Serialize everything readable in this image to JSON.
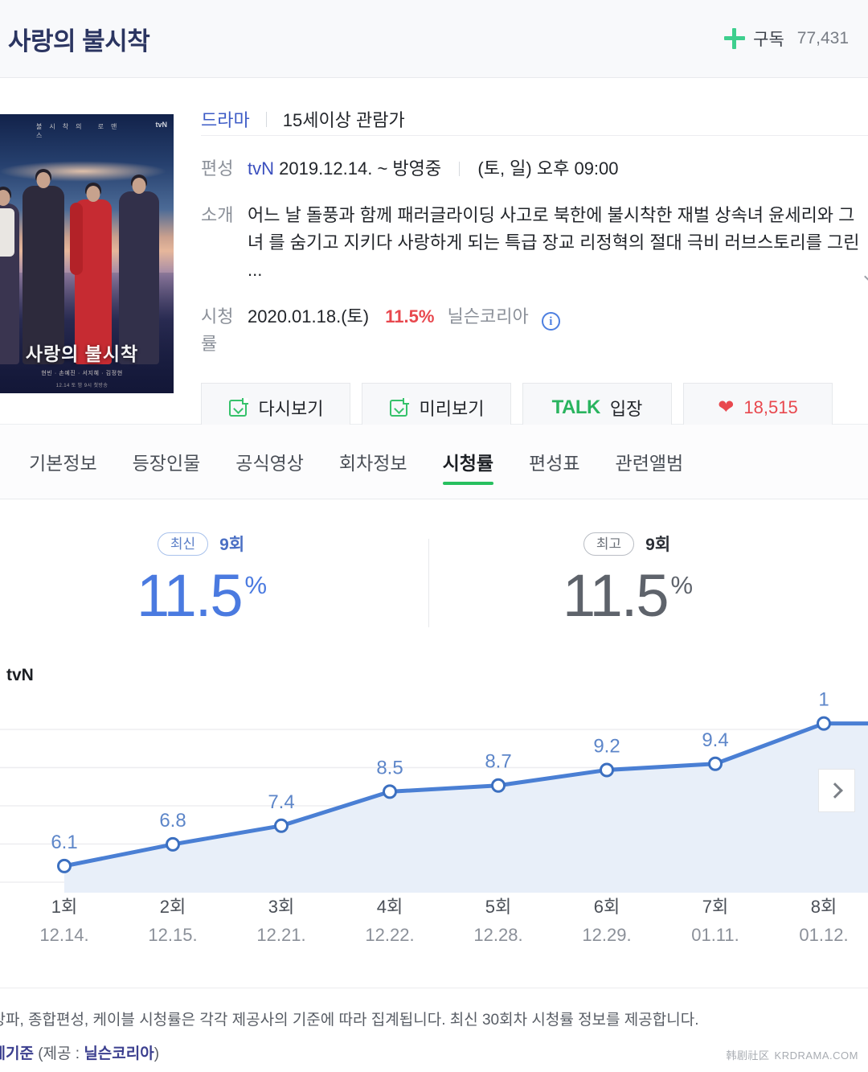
{
  "header": {
    "title": "사랑의 불시착",
    "subscribe_label": "구독",
    "subscribe_count": "77,431",
    "plus_icon": "plus-icon",
    "accent_green": "#3ecf8e",
    "title_color": "#2b3561"
  },
  "poster": {
    "title": "사랑의 불시착",
    "tagline": "불시착의 로맨스",
    "network_logo": "tvN",
    "credits": "현빈 · 손예진 · 서지혜 · 김정현",
    "credits2": "12.14 토 밤 9시 첫방송"
  },
  "info": {
    "genre": "드라마",
    "rating": "15세이상 관람가",
    "schedule_label": "편성",
    "channel": "tvN",
    "air_period": "2019.12.14. ~ 방영중",
    "air_time": "(토, 일) 오후 09:00",
    "synopsis_label": "소개",
    "synopsis_line1": "어느 날 돌풍과 함께 패러글라이딩 사고로 북한에 불시착한 재벌 상속녀 윤세리와 그녀",
    "synopsis_line2": "를 숨기고 지키다 사랑하게 되는 특급 장교 리정혁의 절대 극비 러브스토리를 그린 ...",
    "rating_label": "시청률",
    "rating_date": "2020.01.18.(토)",
    "rating_value": "11.5%",
    "rating_source": "닐슨코리아",
    "info_icon": "info-circle-icon",
    "rating_color": "#e8484e"
  },
  "buttons": {
    "vod": "다시보기",
    "preview": "미리보기",
    "talk_brand": "TALK",
    "talk_label": "입장",
    "like_icon": "heart-icon",
    "like_count": "18,515"
  },
  "tabs": [
    {
      "label": "기본정보",
      "active": false
    },
    {
      "label": "등장인물",
      "active": false
    },
    {
      "label": "공식영상",
      "active": false
    },
    {
      "label": "회차정보",
      "active": false
    },
    {
      "label": "시청률",
      "active": true
    },
    {
      "label": "편성표",
      "active": false
    },
    {
      "label": "관련앨범",
      "active": false
    }
  ],
  "stats": {
    "latest": {
      "badge": "최신",
      "episode": "9회",
      "value": "11.5",
      "unit": "%"
    },
    "best": {
      "badge": "최고",
      "episode": "9회",
      "value": "11.5",
      "unit": "%"
    }
  },
  "chart_data": {
    "type": "line",
    "title": "tvN",
    "xlabel": "",
    "ylabel": "",
    "ylim": [
      5.5,
      11.6
    ],
    "grid": true,
    "legend": false,
    "categories": [
      "1회",
      "2회",
      "3회",
      "4회",
      "5회",
      "6회",
      "7회",
      "8회"
    ],
    "tick_dates": [
      "12.14.",
      "12.15.",
      "12.21.",
      "12.22.",
      "12.28.",
      "12.29.",
      "01.11.",
      "01.12."
    ],
    "values": [
      6.1,
      6.8,
      7.4,
      8.5,
      8.7,
      9.2,
      9.4,
      10.7
    ],
    "value_labels": [
      "6.1",
      "6.8",
      "7.4",
      "8.5",
      "8.7",
      "9.2",
      "9.4",
      "1"
    ],
    "series": [
      {
        "name": "tvN",
        "values": [
          6.1,
          6.8,
          7.4,
          8.5,
          8.7,
          9.2,
          9.4,
          10.7
        ]
      }
    ],
    "line_color": "#4a7fd4",
    "fill_color": "#e8eff9",
    "marker_fill": "#ffffff",
    "next_button": "next-page-arrow"
  },
  "footer": {
    "note_line1": "지상파, 종합편성, 케이블 시청률은 각각 제공사의 기준에 따라 집계됩니다. 최신 30회차 시청률 정보를 제공합니다.",
    "note_line2_strong": "집계기준",
    "note_line2_mid": " (제공 : ",
    "note_line2_src": "닐슨코리아",
    "note_line2_end": ")",
    "watermark_cn": "韩剧社区",
    "watermark_site": "KRDRAMA.COM"
  }
}
